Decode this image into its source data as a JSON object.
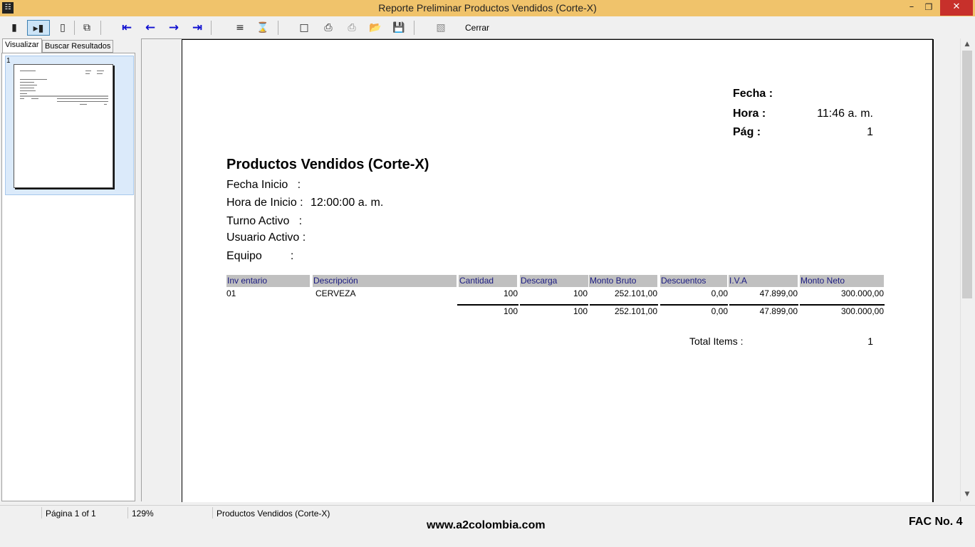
{
  "window": {
    "title": "Reporte Preliminar Productos Vendidos (Corte-X)",
    "minimize": "–",
    "maximize": "❐",
    "close": "✕"
  },
  "toolbar": {
    "close_label": "Cerrar"
  },
  "left_panel": {
    "tabs": [
      "Visualizar",
      "Buscar Resultados"
    ],
    "thumbnail_number": "1"
  },
  "report": {
    "header": {
      "fecha_label": "Fecha :",
      "hora_label": "Hora :",
      "hora_value": "11:46 a. m.",
      "pag_label": "Pág :",
      "pag_value": "1"
    },
    "title": "Productos Vendidos (Corte-X)",
    "meta": {
      "fecha_inicio_label": "Fecha Inicio   :",
      "hora_inicio_label": "Hora de Inicio :",
      "hora_inicio_value": "12:00:00 a. m.",
      "turno_label": "Turno Activo   :",
      "usuario_label": "Usuario Activo :",
      "equipo_label": "Equipo         :"
    },
    "columns": [
      "Inv entario",
      "Descripción",
      "Cantidad",
      "Descarga",
      "Monto Bruto",
      "Descuentos",
      "I.V.A",
      "Monto Neto"
    ],
    "rows": [
      {
        "inventario": "01",
        "descripcion": "CERVEZA",
        "cantidad": "100",
        "descarga": "100",
        "monto_bruto": "252.101,00",
        "descuentos": "0,00",
        "iva": "47.899,00",
        "monto_neto": "300.000,00"
      }
    ],
    "totals": {
      "cantidad": "100",
      "descarga": "100",
      "monto_bruto": "252.101,00",
      "descuentos": "0,00",
      "iva": "47.899,00",
      "monto_neto": "300.000,00"
    },
    "total_items_label": "Total Items :",
    "total_items_value": "1"
  },
  "status": {
    "page": "Página 1 of 1",
    "zoom": "129%",
    "report_name": "Productos Vendidos (Corte-X)"
  },
  "footer": {
    "url": "www.a2colombia.com",
    "fac": "FAC No. 4"
  },
  "colors": {
    "titlebar": "#f0c36b",
    "close_button": "#c7302b",
    "nav_arrows": "#1010d0",
    "column_header_bg": "#c0c0c0",
    "column_header_text": "#1a1a80"
  }
}
